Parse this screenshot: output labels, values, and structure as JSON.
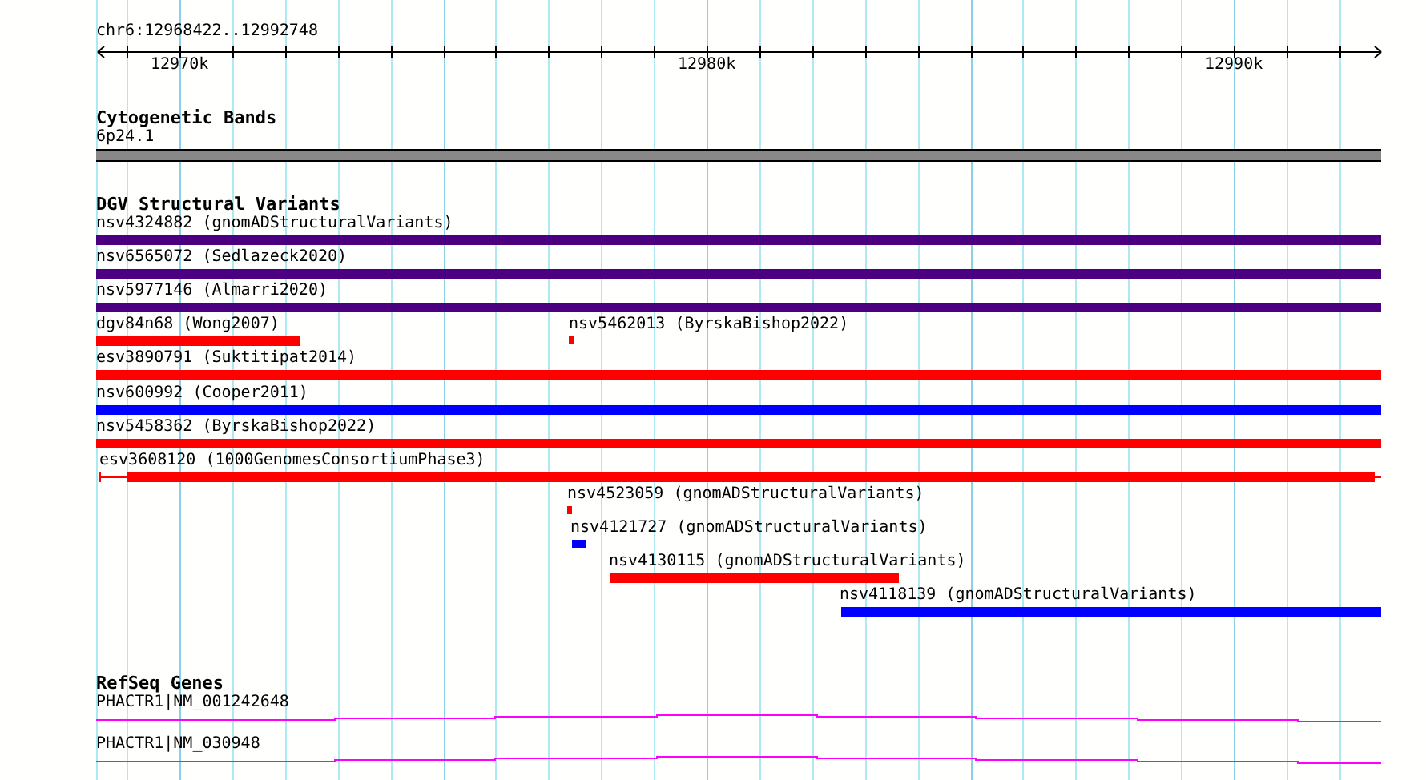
{
  "ruler": {
    "position": "chr6:12968422..12992748",
    "ticks": [
      "12970k",
      "12980k",
      "12990k"
    ]
  },
  "tracks": [
    {
      "kind": "bands",
      "title": "Cytogenetic Bands",
      "items": [
        {
          "label": "6p24.1"
        }
      ]
    },
    {
      "kind": "variants",
      "title": "DGV Structural Variants",
      "items": [
        {
          "label": "nsv4324882 (gnomADStructuralVariants)",
          "color": "#4b0082"
        },
        {
          "label": "nsv6565072 (Sedlazeck2020)",
          "color": "#4b0082"
        },
        {
          "label": "nsv5977146 (Almarri2020)",
          "color": "#4b0082"
        },
        {
          "label": "dgv84n68 (Wong2007)",
          "color": "#ff0000"
        },
        {
          "label": "nsv5462013 (ByrskaBishop2022)",
          "color": "#ff0000"
        },
        {
          "label": "esv3890791 (Suktitipat2014)",
          "color": "#ff0000"
        },
        {
          "label": "nsv600992 (Cooper2011)",
          "color": "#0000ff"
        },
        {
          "label": "nsv5458362 (ByrskaBishop2022)",
          "color": "#ff0000"
        },
        {
          "label": "esv3608120 (1000GenomesConsortiumPhase3)",
          "color": "#ff0000"
        },
        {
          "label": "nsv4523059 (gnomADStructuralVariants)",
          "color": "#ff0000"
        },
        {
          "label": "nsv4121727 (gnomADStructuralVariants)",
          "color": "#0000ff"
        },
        {
          "label": "nsv4130115 (gnomADStructuralVariants)",
          "color": "#ff0000"
        },
        {
          "label": "nsv4118139 (gnomADStructuralVariants)",
          "color": "#0000ff"
        }
      ]
    },
    {
      "kind": "genes",
      "title": "RefSeq Genes",
      "items": [
        {
          "label": "PHACTR1|NM_001242648"
        },
        {
          "label": "PHACTR1|NM_030948"
        }
      ]
    }
  ]
}
